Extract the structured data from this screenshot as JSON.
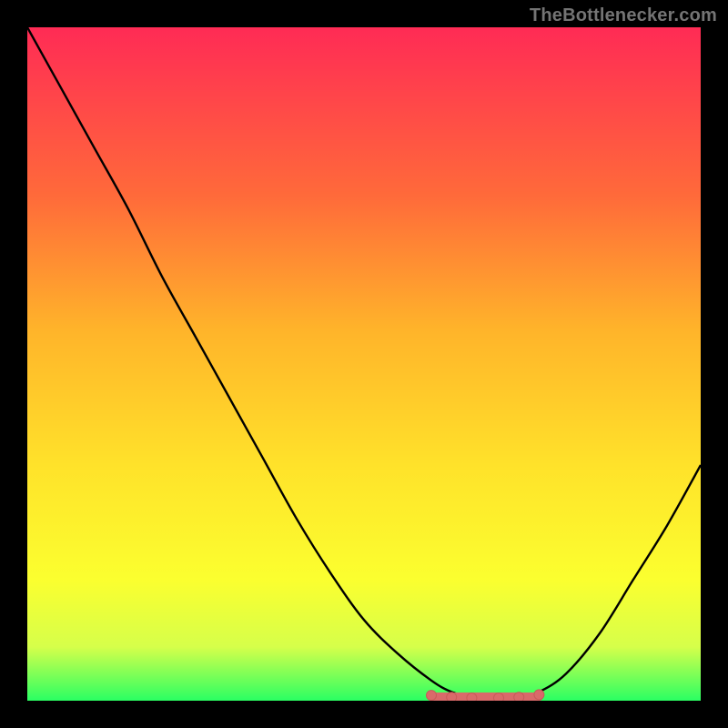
{
  "attribution": "TheBottlenecker.com",
  "colors": {
    "gradient_top": "#ff2b55",
    "gradient_mid1": "#ff6a3a",
    "gradient_mid2": "#ffb42a",
    "gradient_mid3": "#ffe22a",
    "gradient_mid4": "#fbff2f",
    "gradient_mid5": "#d6ff4a",
    "gradient_bottom": "#2aff63",
    "curve": "#000000",
    "marker_fill": "#d96a6a",
    "marker_stroke": "#c85a58"
  },
  "chart_data": {
    "type": "line",
    "title": "",
    "xlabel": "",
    "ylabel": "",
    "xlim": [
      0,
      100
    ],
    "ylim": [
      0,
      100
    ],
    "x": [
      0,
      5,
      10,
      15,
      20,
      25,
      30,
      35,
      40,
      45,
      50,
      55,
      60,
      63,
      66,
      70,
      73,
      76,
      80,
      85,
      90,
      95,
      100
    ],
    "y": [
      100,
      91,
      82,
      73,
      63,
      54,
      45,
      36,
      27,
      19,
      12,
      7,
      3,
      1.3,
      0.5,
      0.2,
      0.5,
      1.3,
      4,
      10,
      18,
      26,
      35
    ],
    "flat_segment": {
      "x_start": 60,
      "x_end": 76,
      "y": 0.6
    },
    "markers": [
      {
        "x": 60,
        "y": 0.8
      },
      {
        "x": 63,
        "y": 0.5
      },
      {
        "x": 66,
        "y": 0.4
      },
      {
        "x": 70,
        "y": 0.4
      },
      {
        "x": 73,
        "y": 0.5
      },
      {
        "x": 76,
        "y": 0.9
      }
    ]
  }
}
